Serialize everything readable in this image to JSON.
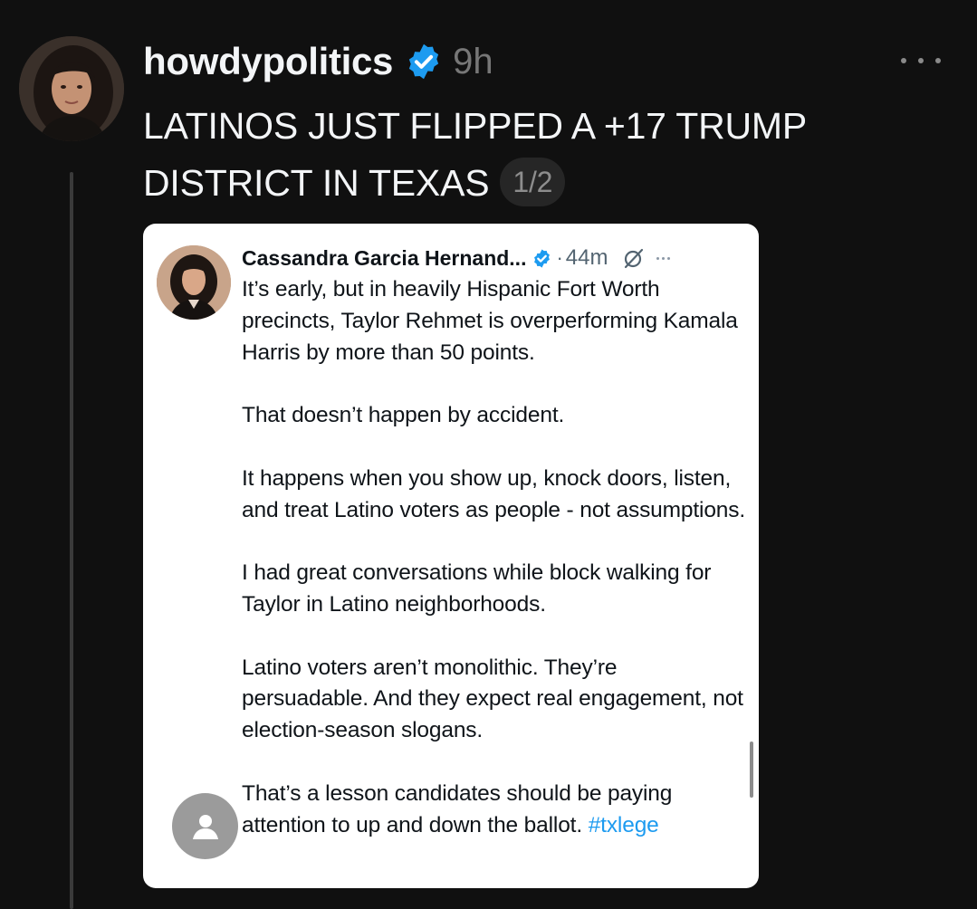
{
  "post": {
    "username": "howdypolitics",
    "timestamp": "9h",
    "text": "LATINOS JUST FLIPPED A +17 TRUMP DISTRICT IN TEXAS",
    "page_indicator": "1/2",
    "avatar_icon": "user-avatar-photo",
    "verified_icon": "verified-badge-icon",
    "more_icon": "more-dots-icon"
  },
  "embedded_post": {
    "author_name": "Cassandra Garcia Hernand...",
    "separator": "·",
    "time": "44m",
    "paragraphs": [
      "It’s early, but in heavily Hispanic Fort Worth precincts, Taylor Rehmet is overperforming Kamala Harris by more than 50 points.",
      "That doesn’t happen by accident.",
      "It happens when you show up, knock doors, listen, and treat Latino voters as people - not assumptions.",
      "I had great conversations while block walking for Taylor in Latino neighborhoods.",
      "Latino voters aren’t monolithic. They’re persuadable. And they expect real engagement, not election-season slogans.",
      "That’s a lesson candidates should be paying attention to up and down the ballot."
    ],
    "hashtag": "#txlege",
    "icons": [
      "verified-badge-icon",
      "grok-icon",
      "more-dots-icon",
      "person-placeholder-icon"
    ]
  },
  "colors": {
    "background": "#101010",
    "text_primary": "#f3f5f7",
    "text_muted": "#777777",
    "verified_blue": "#1d9bf0",
    "card_background": "#ffffff",
    "link": "#1d9bf0"
  }
}
